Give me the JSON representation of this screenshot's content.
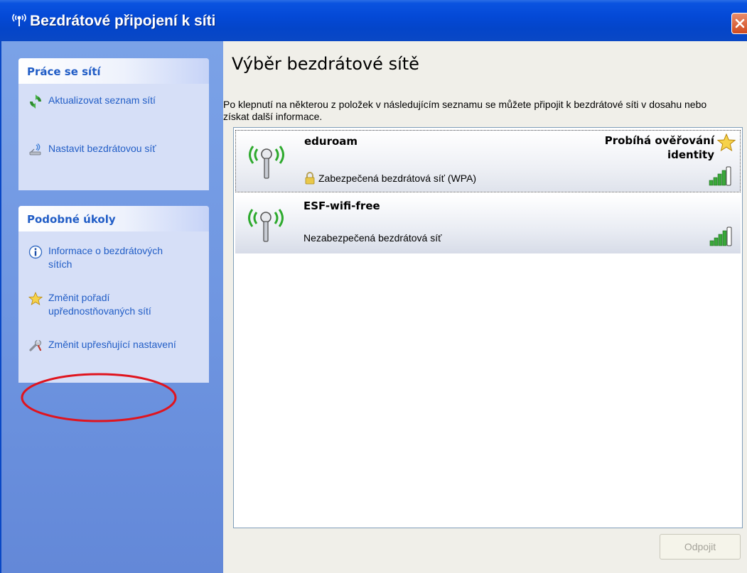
{
  "window": {
    "title": "Bezdrátové připojení k síti",
    "close_label": "",
    "title_icon": "wireless-network-icon"
  },
  "sidebar": {
    "network_tasks": {
      "title": "Práce se sítí",
      "items": [
        {
          "label": "Aktualizovat seznam sítí",
          "icon": "refresh-icon"
        },
        {
          "label": "Nastavit bezdrátovou síť",
          "icon": "wireless-setup-icon"
        }
      ]
    },
    "related_tasks": {
      "title": "Podobné úkoly",
      "items": [
        {
          "label": "Informace o bezdrátových sítích",
          "icon": "info-icon"
        },
        {
          "label": "Změnit pořadí upřednostňovaných sítí",
          "icon": "star-icon"
        },
        {
          "label": "Změnit upřesňující nastavení",
          "icon": "wrench-icon",
          "highlighted": true
        }
      ]
    }
  },
  "main": {
    "heading": "Výběr bezdrátové sítě",
    "intro": "Po klepnutí na některou z položek v následujícím seznamu se můžete připojit k bezdrátové síti v dosahu nebo získat další informace.",
    "networks": [
      {
        "ssid": "eduroam",
        "status": "Probíhá ověřování identity",
        "security": "Zabezpečená bezdrátová síť (WPA)",
        "secured": true,
        "signal_bars": 5,
        "selected": true
      },
      {
        "ssid": "ESF-wifi-free",
        "status": "",
        "security": "Nezabezpečená bezdrátová síť",
        "secured": false,
        "signal_bars": 5,
        "selected": false
      }
    ],
    "disconnect_label": "Odpojit"
  },
  "colors": {
    "title_bar": "#0449d6",
    "sidebar_bg": "#6f96e1",
    "panel_bg": "#d6dff7",
    "link": "#215dc6",
    "annotation": "#e0141e",
    "signal": "#3aa83a"
  }
}
